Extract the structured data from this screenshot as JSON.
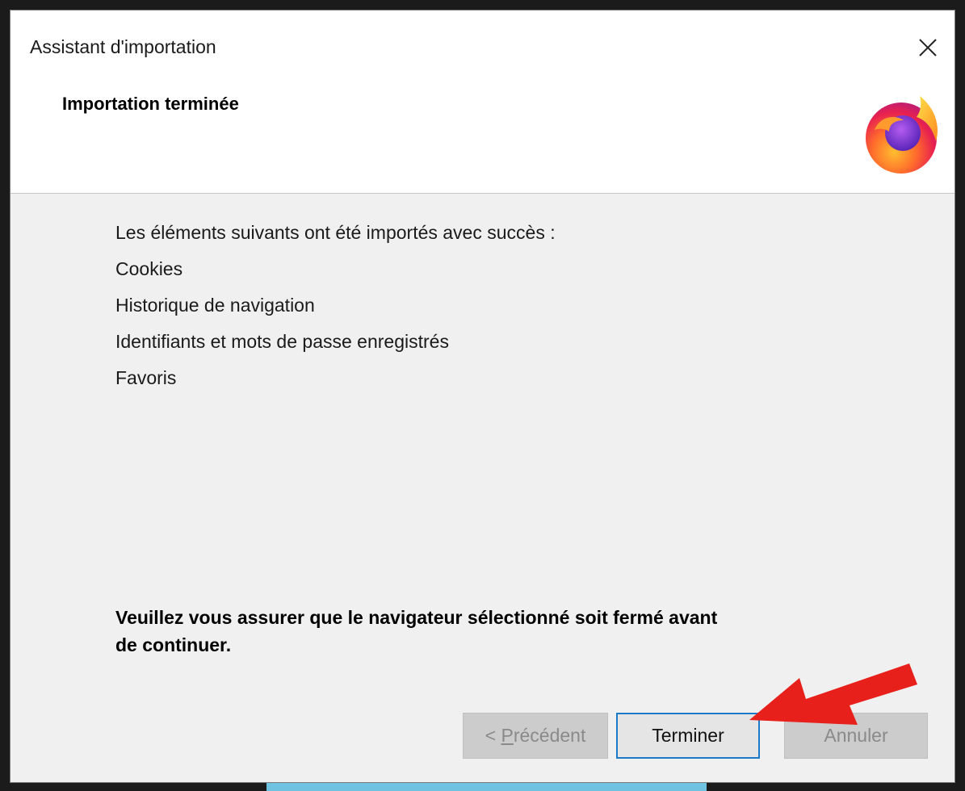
{
  "window": {
    "title": "Assistant d'importation",
    "close_label": "×"
  },
  "header": {
    "heading": "Importation terminée",
    "logo_icon": "firefox-logo-icon"
  },
  "content": {
    "intro": "Les éléments suivants ont été importés avec succès :",
    "items": [
      "Cookies",
      "Historique de navigation",
      "Identifiants et mots de passe enregistrés",
      "Favoris"
    ]
  },
  "warning": {
    "line1": "Veuillez vous assurer que le navigateur sélectionné soit fermé avant",
    "line2": "de continuer."
  },
  "buttons": {
    "prev_prefix": "< ",
    "prev_access_key": "P",
    "prev_rest": "récédent",
    "finish": "Terminer",
    "cancel": "Annuler"
  },
  "annotation": {
    "arrow_color": "#e8201c",
    "arrow_icon": "red-arrow-pointer-icon"
  },
  "colors": {
    "focus_border": "#1d7ac7",
    "disabled_text": "#8a8a8a",
    "header_bg": "#ffffff",
    "body_bg": "#f0f0f0"
  }
}
